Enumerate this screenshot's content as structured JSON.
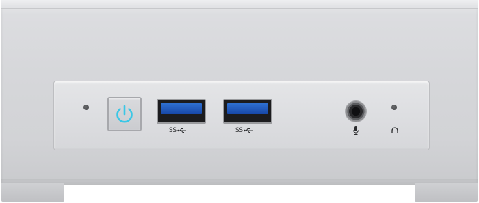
{
  "device": {
    "name": "mini-pc-front-view",
    "colors": {
      "chassis": "#d6d7da",
      "power_icon": "#3bc7e6",
      "usb_tongue": "#1f57b8"
    },
    "ports": {
      "usb_a_label": "SS",
      "usb_b_label": "SS"
    },
    "icons": {
      "power": "power-icon",
      "mic": "microphone-icon",
      "headphones": "headphone-icon"
    }
  }
}
